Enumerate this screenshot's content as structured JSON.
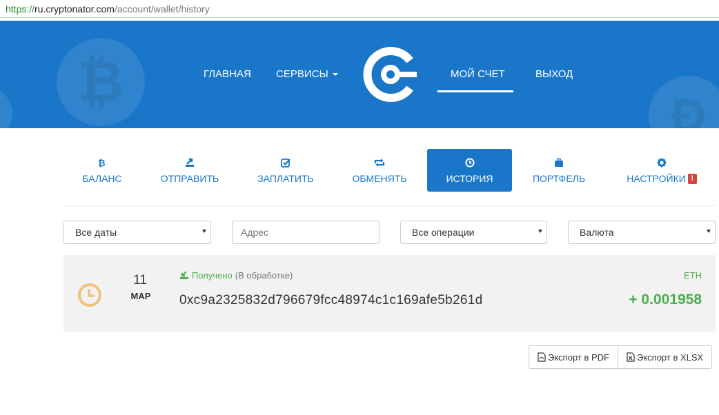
{
  "browser": {
    "url_scheme": "https://",
    "url_host": "ru.cryptonator.com",
    "url_path": "/account/wallet/history"
  },
  "header": {
    "background_color": "#1976c8",
    "nav": {
      "home": "ГЛАВНАЯ",
      "services": "СЕРВИСЫ",
      "account": "МОЙ СЧЕТ",
      "logout": "ВЫХОД"
    },
    "active_item": "account",
    "logo_icon": "cryptonator-logo",
    "background_icons": [
      "bitcoin-icon",
      "dogecoin-icon"
    ]
  },
  "tabs": [
    {
      "label": "БАЛАНС",
      "icon": "bitcoin-icon"
    },
    {
      "label": "ОТПРАВИТЬ",
      "icon": "send-icon"
    },
    {
      "label": "ЗАПЛАТИТЬ",
      "icon": "check-icon"
    },
    {
      "label": "ОБМЕНЯТЬ",
      "icon": "exchange-icon"
    },
    {
      "label": "ИСТОРИЯ",
      "icon": "clock-icon",
      "active": true
    },
    {
      "label": "ПОРТФЕЛЬ",
      "icon": "briefcase-icon"
    },
    {
      "label": "НАСТРОЙКИ",
      "icon": "gear-icon",
      "badge": "!"
    }
  ],
  "filters": {
    "dates": {
      "selected": "Все даты"
    },
    "address": {
      "placeholder": "Адрес"
    },
    "operations": {
      "selected": "Все операции"
    },
    "currency": {
      "selected": "Валюта"
    }
  },
  "transactions": [
    {
      "status_icon": "clock-icon",
      "day": "11",
      "month": "МАР",
      "type_icon": "receive-icon",
      "type": "Получено",
      "state": "(В обработке)",
      "address": "0xc9a2325832d796679fcc48974c1c169afe5b261d",
      "currency": "ETH",
      "amount": "+ 0.001958"
    }
  ],
  "export": {
    "pdf": "Экспорт в PDF",
    "xlsx": "Экспорт в XLSX"
  },
  "colors": {
    "accent": "#1976c8",
    "positive": "#4cae4c",
    "pending": "#f0c27b",
    "alert": "#d9443f"
  }
}
